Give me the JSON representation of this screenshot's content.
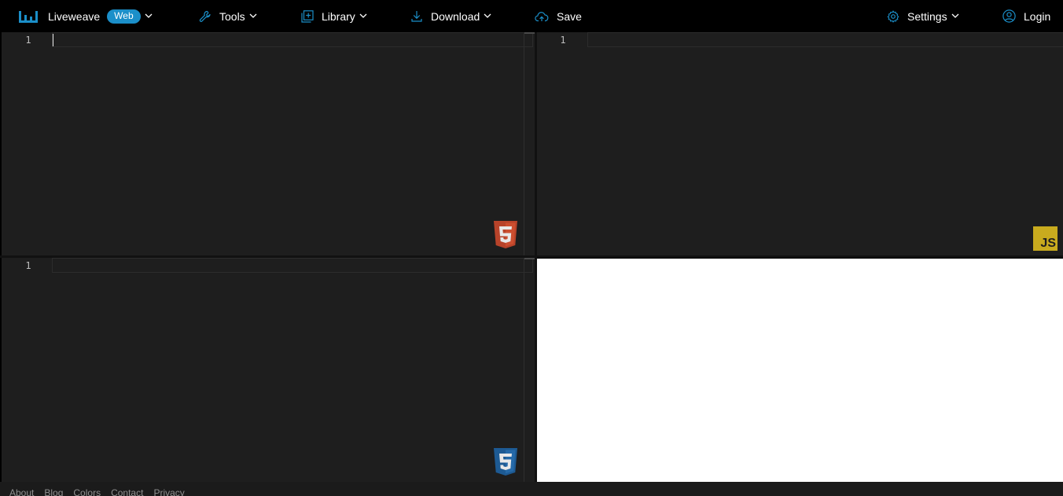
{
  "navbar": {
    "brand": {
      "name": "Liveweave",
      "badge": "Web",
      "icon": "bars-logo-icon"
    },
    "tools": {
      "label": "Tools",
      "icon": "wrench-icon"
    },
    "library": {
      "label": "Library",
      "icon": "library-add-icon"
    },
    "download": {
      "label": "Download",
      "icon": "download-icon"
    },
    "save": {
      "label": "Save",
      "icon": "cloud-upload-icon"
    },
    "settings": {
      "label": "Settings",
      "icon": "gear-icon"
    },
    "login": {
      "label": "Login",
      "icon": "user-circle-icon"
    }
  },
  "editors": {
    "html": {
      "line_number": "1",
      "badge_icon": "html5-icon"
    },
    "js": {
      "line_number": "1",
      "badge_icon": "js-icon",
      "badge_text": "JS"
    },
    "css": {
      "line_number": "1",
      "badge_icon": "css3-icon"
    }
  },
  "footer": {
    "links": [
      "About",
      "Blog",
      "Colors",
      "Contact",
      "Privacy"
    ]
  },
  "colors": {
    "accent": "#1b8fc9",
    "editor_bg": "#1e1e1e",
    "html_badge": "#c0462a",
    "css_badge": "#1f5f9b",
    "js_badge": "#c9ab1e"
  }
}
